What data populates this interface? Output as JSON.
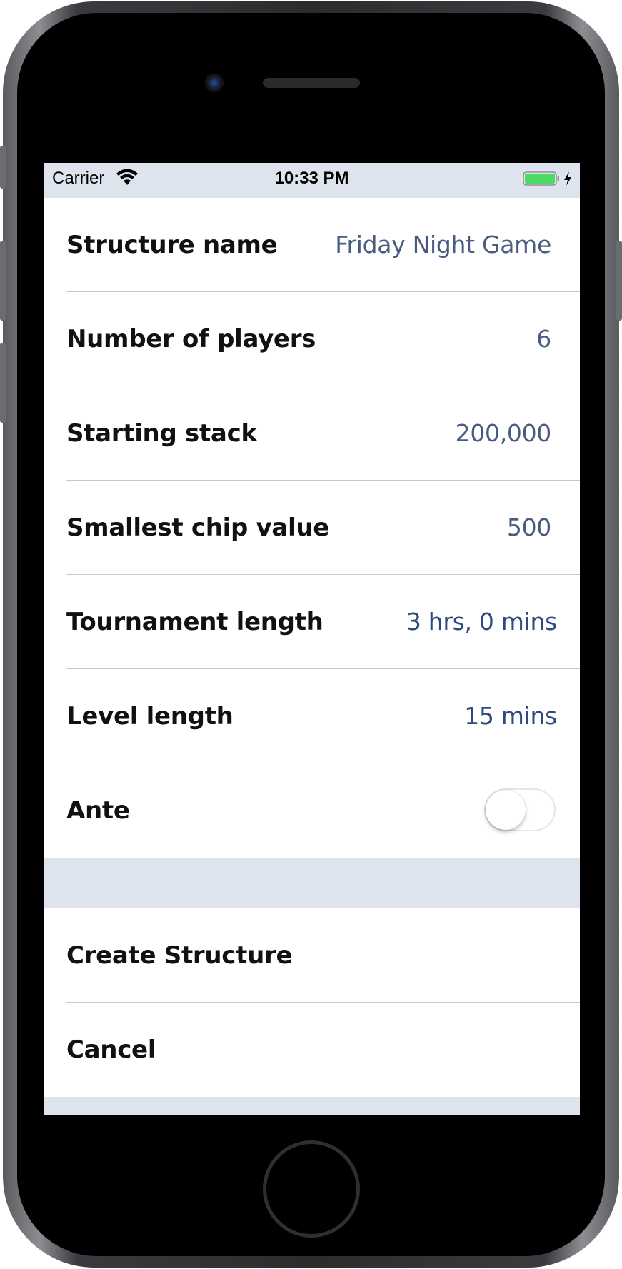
{
  "status_bar": {
    "carrier": "Carrier",
    "time": "10:33 PM",
    "battery_color": "#4cd964"
  },
  "form": {
    "rows": [
      {
        "label": "Structure name",
        "value": "Friday Night Game"
      },
      {
        "label": "Number of players",
        "value": "6"
      },
      {
        "label": "Starting stack",
        "value": "200,000"
      },
      {
        "label": "Smallest chip value",
        "value": "500"
      },
      {
        "label": "Tournament length",
        "value": "3 hrs, 0 mins"
      },
      {
        "label": "Level length",
        "value": "15 mins"
      }
    ],
    "ante": {
      "label": "Ante",
      "enabled": false
    }
  },
  "actions": {
    "create_label": "Create Structure",
    "cancel_label": "Cancel"
  },
  "colors": {
    "background": "#dee4ee",
    "value_text": "#4a5a80",
    "link_value_text": "#2e4a7e"
  },
  "icons": [
    "wifi-icon",
    "battery-icon",
    "charging-bolt-icon"
  ]
}
